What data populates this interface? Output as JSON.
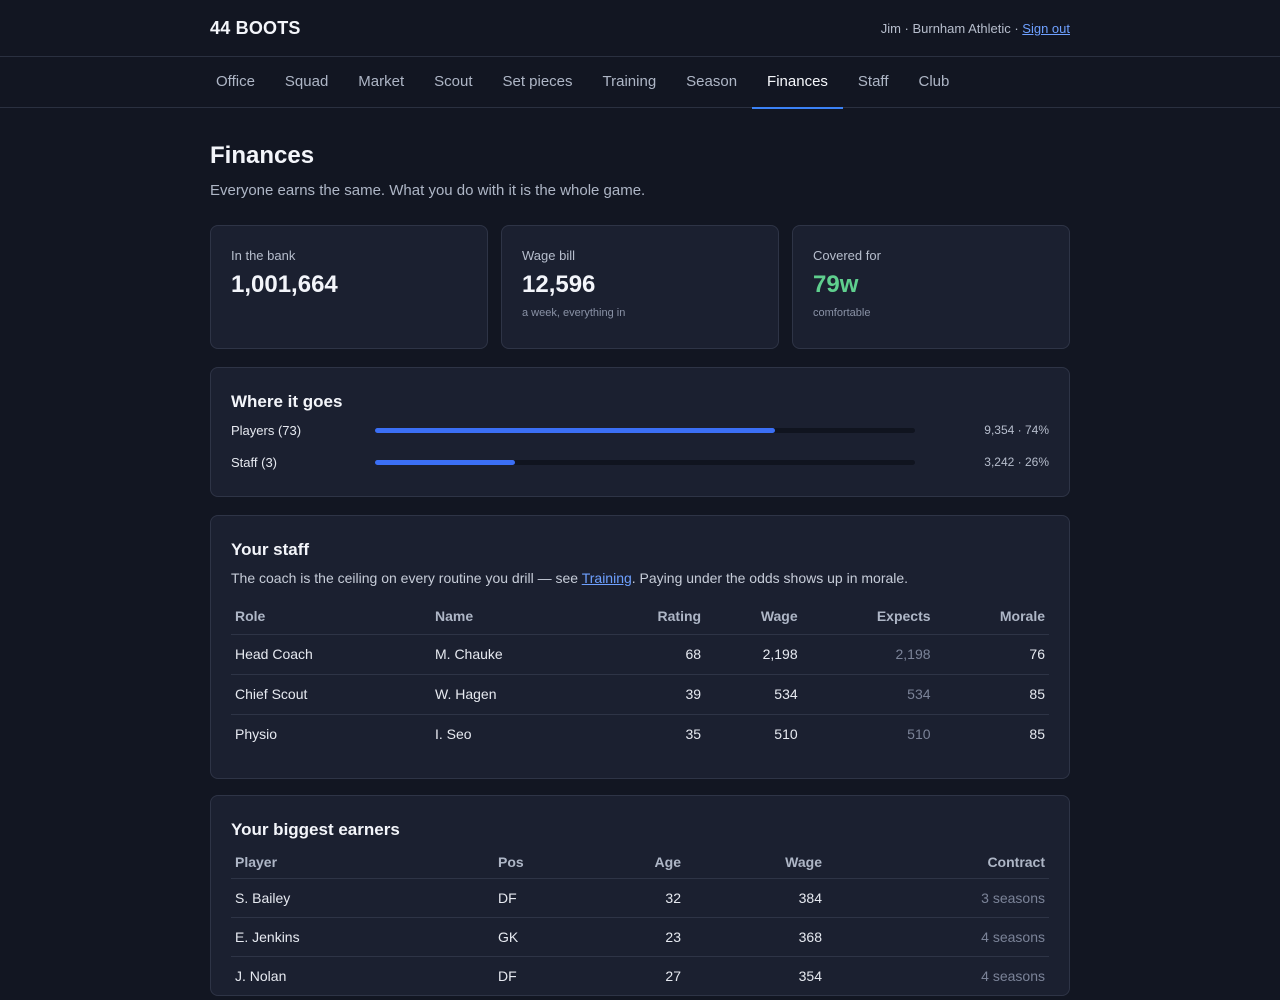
{
  "header": {
    "brand": "44 BOOTS",
    "user_line": "Jim · Burnham Athletic · ",
    "sign_out": "Sign out"
  },
  "nav": {
    "tabs": [
      "Office",
      "Squad",
      "Market",
      "Scout",
      "Set pieces",
      "Training",
      "Season",
      "Finances",
      "Staff",
      "Club"
    ],
    "active": "Finances"
  },
  "page": {
    "title": "Finances",
    "subtitle": "Everyone earns the same. What you do with it is the whole game."
  },
  "stats": {
    "bank": {
      "label": "In the bank",
      "value": "1,001,664"
    },
    "wage_bill": {
      "label": "Wage bill",
      "value": "12,596",
      "note": "a week, everything in"
    },
    "covered": {
      "label": "Covered for",
      "value": "79w",
      "note": "comfortable"
    }
  },
  "where_it_goes": {
    "title": "Where it goes",
    "rows": [
      {
        "label": "Players (73)",
        "value": "9,354 · 74%",
        "fraction": 0.74
      },
      {
        "label": "Staff (3)",
        "value": "3,242 · 26%",
        "fraction": 0.26
      }
    ]
  },
  "staff": {
    "title": "Your staff",
    "desc_before": "The coach is the ceiling on every routine you drill — see ",
    "desc_link": "Training",
    "desc_after": ". Paying under the odds shows up in morale.",
    "columns": [
      "Role",
      "Name",
      "Rating",
      "Wage",
      "Expects",
      "Morale"
    ],
    "rows": [
      [
        "Head Coach",
        "M. Chauke",
        "68",
        "2,198",
        "2,198",
        "76"
      ],
      [
        "Chief Scout",
        "W. Hagen",
        "39",
        "534",
        "534",
        "85"
      ],
      [
        "Physio",
        "I. Seo",
        "35",
        "510",
        "510",
        "85"
      ]
    ]
  },
  "earners": {
    "title": "Your biggest earners",
    "columns": [
      "Player",
      "Pos",
      "Age",
      "Wage",
      "Contract"
    ],
    "rows": [
      [
        "S. Bailey",
        "DF",
        "32",
        "384",
        "3 seasons"
      ],
      [
        "E. Jenkins",
        "GK",
        "23",
        "368",
        "4 seasons"
      ],
      [
        "J. Nolan",
        "DF",
        "27",
        "354",
        "4 seasons"
      ]
    ]
  },
  "colors": {
    "accent": "#3b82f6",
    "good": "#5fcf8e",
    "background": "#121622",
    "panel": "#1b2030"
  }
}
